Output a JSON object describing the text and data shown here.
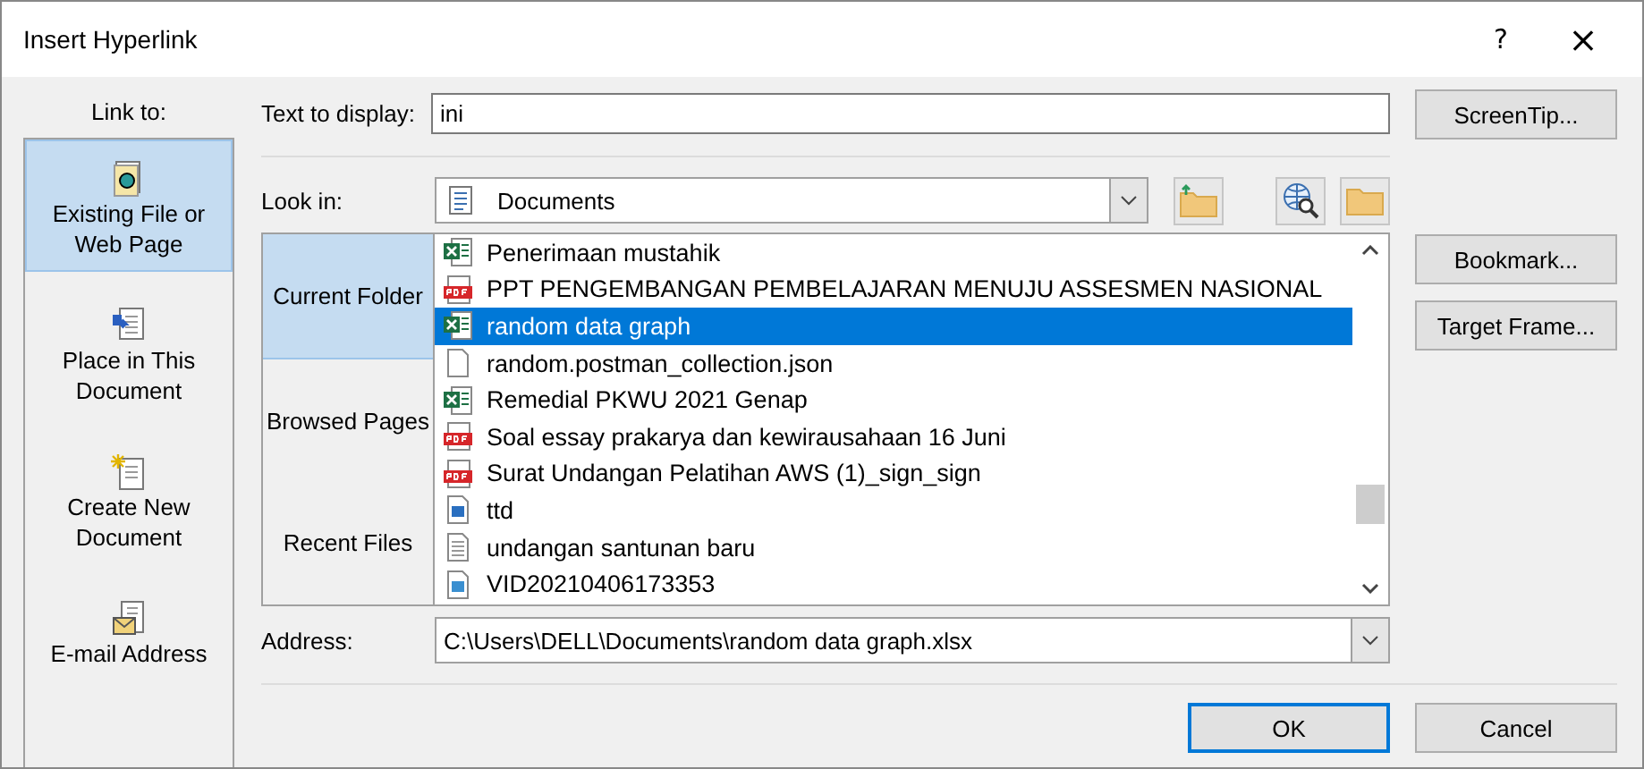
{
  "window": {
    "title": "Insert Hyperlink",
    "help": "?",
    "close": "×"
  },
  "link_to": {
    "label": "Link to:",
    "items": [
      {
        "label": "Existing File or Web Page",
        "kind": "file",
        "selected": true
      },
      {
        "label": "Place in This Document",
        "kind": "place",
        "selected": false
      },
      {
        "label": "Create New Document",
        "kind": "new",
        "selected": false
      },
      {
        "label": "E-mail Address",
        "kind": "email",
        "selected": false
      }
    ]
  },
  "text_to_display": {
    "label": "Text to display:",
    "value": "ini"
  },
  "screentip_button": "ScreenTip...",
  "look_in": {
    "label": "Look in:",
    "value": "Documents"
  },
  "browse_tabs": [
    {
      "label": "Current Folder",
      "selected": true
    },
    {
      "label": "Browsed Pages",
      "selected": false
    },
    {
      "label": "Recent Files",
      "selected": false
    }
  ],
  "files": [
    {
      "name": "Penerimaan mustahik",
      "kind": "excel",
      "selected": false
    },
    {
      "name": "PPT PENGEMBANGAN PEMBELAJARAN MENUJU ASSESMEN NASIONAL",
      "kind": "pdf",
      "selected": false
    },
    {
      "name": "random data graph",
      "kind": "excel",
      "selected": true
    },
    {
      "name": "random.postman_collection.json",
      "kind": "blank",
      "selected": false
    },
    {
      "name": "Remedial PKWU 2021 Genap",
      "kind": "excel",
      "selected": false
    },
    {
      "name": "Soal essay prakarya dan kewirausahaan 16 Juni",
      "kind": "pdf",
      "selected": false
    },
    {
      "name": "Surat Undangan Pelatihan AWS (1)_sign_sign",
      "kind": "pdf",
      "selected": false
    },
    {
      "name": "ttd",
      "kind": "image",
      "selected": false
    },
    {
      "name": "undangan santunan baru",
      "kind": "text",
      "selected": false
    },
    {
      "name": "VID20210406173353",
      "kind": "video",
      "selected": false
    }
  ],
  "side_buttons": [
    "Bookmark...",
    "Target Frame..."
  ],
  "address": {
    "label": "Address:",
    "value": "C:\\Users\\DELL\\Documents\\random data graph.xlsx"
  },
  "buttons": [
    {
      "label": "OK",
      "default": true
    },
    {
      "label": "Cancel",
      "default": false
    }
  ]
}
